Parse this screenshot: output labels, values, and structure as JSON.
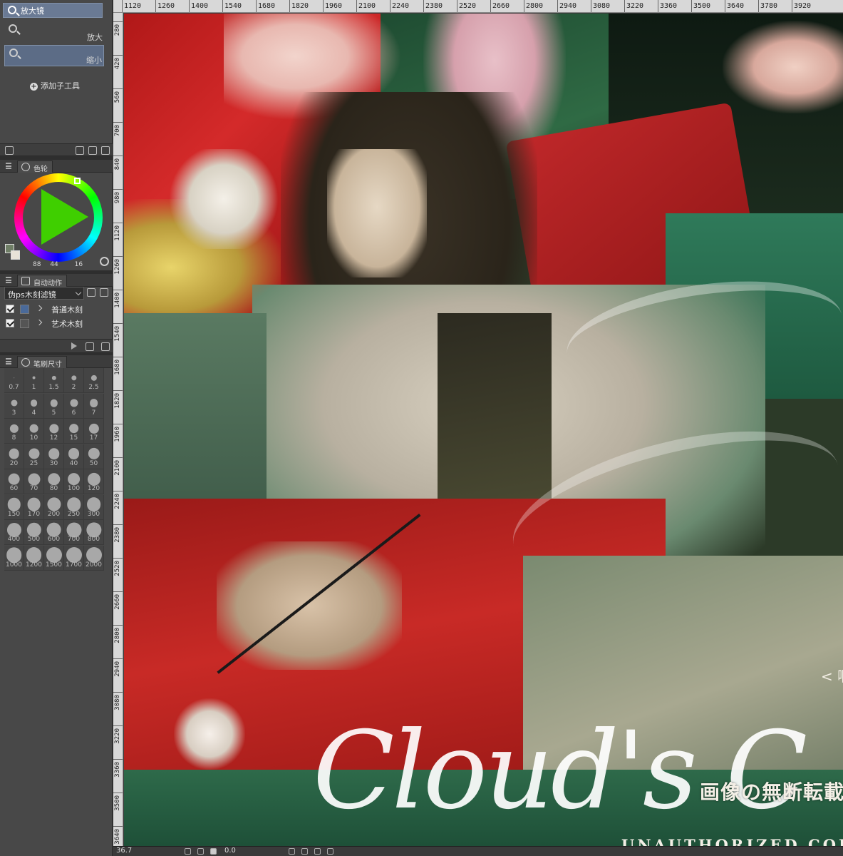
{
  "tool": {
    "name": "放大镜"
  },
  "subtools": [
    {
      "label": "放大"
    },
    {
      "label": "缩小"
    }
  ],
  "add_subtool": "添加子工具",
  "color_panel": {
    "tab": "色轮",
    "values": {
      "h": "88",
      "s": "44",
      "v": "16"
    }
  },
  "auto_action": {
    "tab": "自动动作",
    "set": "伪ps木刻滤镜",
    "items": [
      {
        "label": "普通木刻"
      },
      {
        "label": "艺术木刻"
      }
    ]
  },
  "brush_size": {
    "tab": "笔刷尺寸",
    "sizes": [
      "0.7",
      "1",
      "1.5",
      "2",
      "2.5",
      "3",
      "4",
      "5",
      "6",
      "7",
      "8",
      "10",
      "12",
      "15",
      "17",
      "20",
      "25",
      "30",
      "40",
      "50",
      "60",
      "70",
      "80",
      "100",
      "120",
      "150",
      "170",
      "200",
      "250",
      "300",
      "400",
      "500",
      "600",
      "700",
      "800",
      "1000",
      "1200",
      "1500",
      "1700",
      "2000"
    ]
  },
  "ruler_top": [
    "1120",
    "1260",
    "1400",
    "1540",
    "1680",
    "1820",
    "1960",
    "2100",
    "2240",
    "2380",
    "2520",
    "2660",
    "2800",
    "2940",
    "3080",
    "3220",
    "3360",
    "3500",
    "3640",
    "3780",
    "3920"
  ],
  "ruler_left": [
    "280",
    "420",
    "560",
    "700",
    "840",
    "980",
    "1120",
    "1260",
    "1400",
    "1540",
    "1680",
    "1820",
    "1960",
    "2100",
    "2240",
    "2380",
    "2520",
    "2660",
    "2800",
    "2940",
    "3080",
    "3220",
    "3360",
    "3500",
    "3640"
  ],
  "artwork": {
    "script_title": "Cloud's C",
    "author_line": "< 啊云 & 私人稿件",
    "notice_jp": "画像の無断転載・複製を",
    "notice_en": "UNAUTHORIZED COPYING A"
  },
  "status": {
    "zoom": "36.7",
    "rotation": "0.0"
  },
  "colors": {
    "accent": "#6a7a94",
    "panel": "#484848",
    "ruler": "#d8d8d8"
  }
}
